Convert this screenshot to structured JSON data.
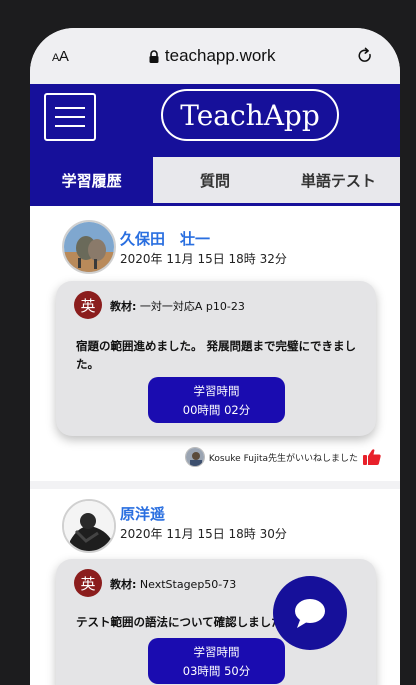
{
  "browser": {
    "aa_label": "AA",
    "url": "teachapp.work"
  },
  "header": {
    "brand": "TeachApp"
  },
  "tabs": [
    {
      "label": "学習履歴",
      "active": true
    },
    {
      "label": "質問",
      "active": false
    },
    {
      "label": "単語テスト",
      "active": false
    }
  ],
  "posts": [
    {
      "author": "久保田　壮一",
      "date": "2020年 11月 15日 18時 32分",
      "subject": "英",
      "material_label": "教材:",
      "material": "一対一対応A p10-23",
      "comment": "宿題の範囲進めました。 発展問題まで完璧にできました。",
      "study_time_label": "学習時間",
      "study_time": "00時間 02分",
      "like_text": "Kosuke Fujita先生がいいねしました"
    },
    {
      "author": "原洋遥",
      "date": "2020年 11月 15日 18時 30分",
      "subject": "英",
      "material_label": "教材:",
      "material": "NextStagep50-73",
      "comment": "テスト範囲の語法について確認しました。",
      "study_time_label": "学習時間",
      "study_time": "03時間 50分"
    }
  ],
  "colors": {
    "brand": "#16109a",
    "button": "#1a0cb0",
    "author": "#2a6fe0",
    "subject_badge": "#8b1d1d",
    "like_thumb": "#e8202a"
  },
  "icons": [
    "lock-icon",
    "reload-icon",
    "hamburger-icon",
    "thumbs-up-icon",
    "chat-bubble-icon"
  ]
}
